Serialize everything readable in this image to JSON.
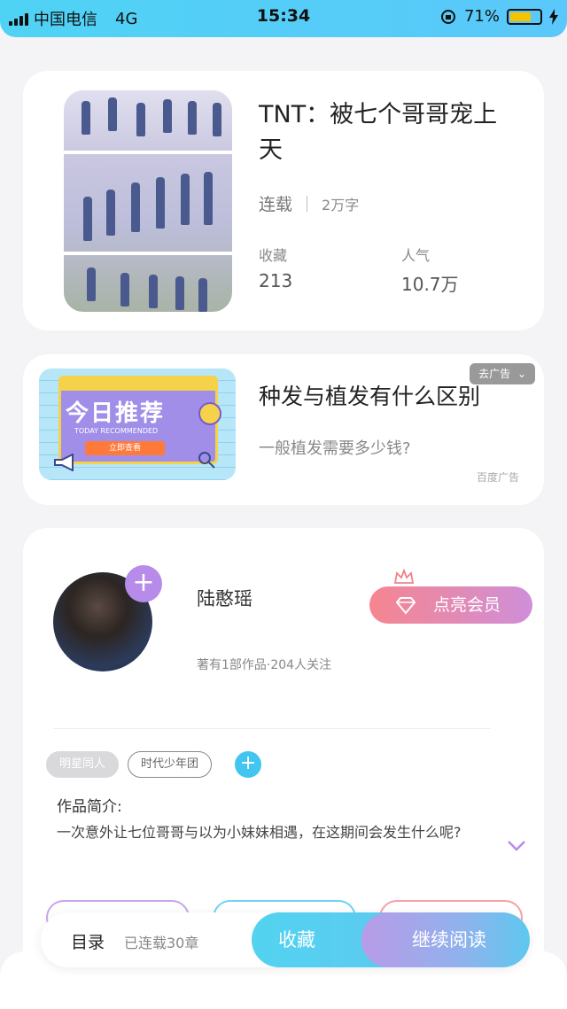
{
  "status_bar": {
    "carrier": "中国电信",
    "network": "4G",
    "time": "15:34",
    "battery_percent": "71%",
    "battery_level": 0.71
  },
  "book": {
    "title": "TNT：被七个哥哥宠上天",
    "status": "连载",
    "word_count": "2万字",
    "favorites_label": "收藏",
    "favorites_value": "213",
    "popularity_label": "人气",
    "popularity_value": "10.7万"
  },
  "ad": {
    "image_headline": "今日推荐",
    "image_subtitle": "TODAY RECOMMENDED",
    "image_button": "立即查看",
    "title": "种发与植发有什么区别",
    "description": "一般植发需要多少钱?",
    "close_label": "去广告",
    "source": "百度广告"
  },
  "author": {
    "name": "陆憨瑶",
    "info": "著有1部作品·204人关注",
    "vip_button": "点亮会员"
  },
  "tags": [
    "明星同人",
    "时代少年团"
  ],
  "intro": {
    "label": "作品简介:",
    "text": "一次意外让七位哥哥与以为小妹妹相遇，在这期间会发生什么呢?"
  },
  "bottom_bar": {
    "toc_label": "目录",
    "chapters_label": "已连载30章",
    "collect_label": "收藏",
    "read_label": "继续阅读"
  },
  "colors": {
    "accent_blue": "#52d3f0",
    "accent_purple": "#b68bea",
    "vip_pink": "#f6858f"
  }
}
